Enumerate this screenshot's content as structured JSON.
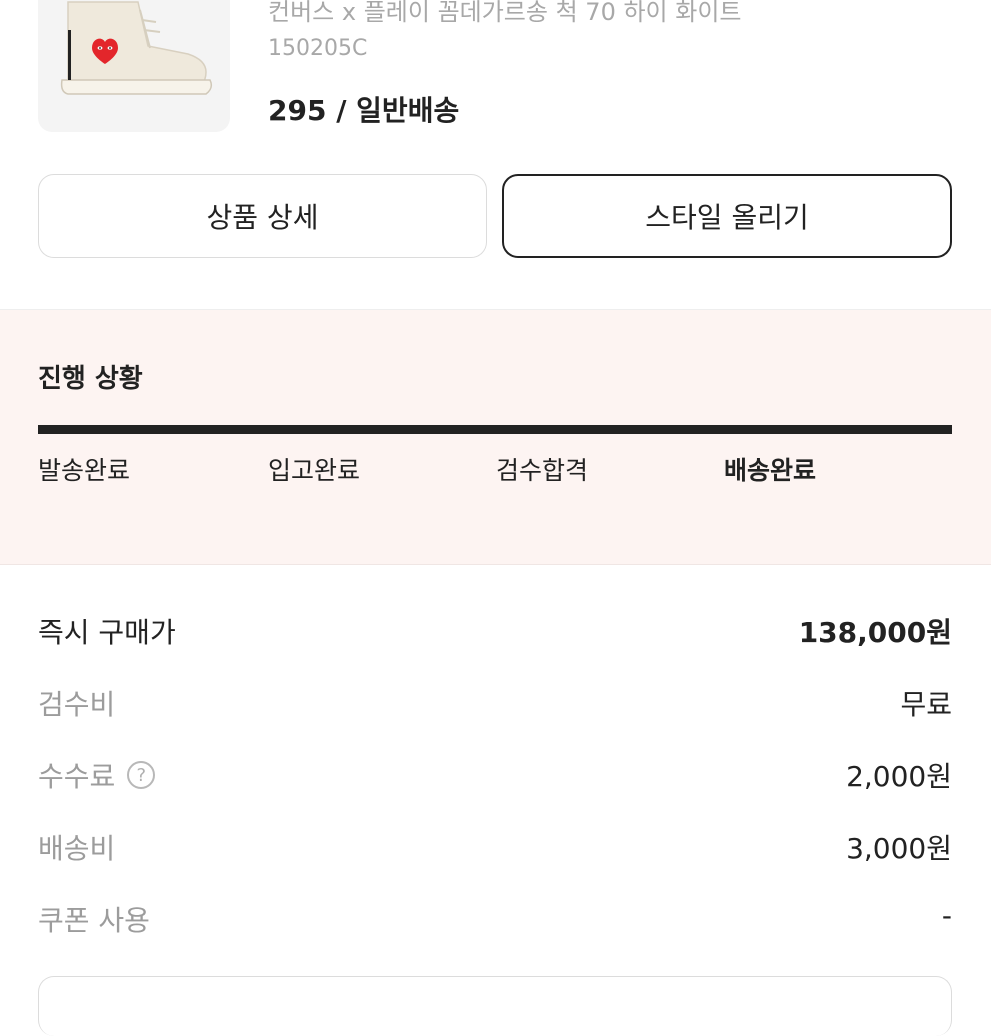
{
  "product": {
    "name": "컨버스 x 플레이 꼼데가르송 척 70 하이 화이트",
    "code": "150205C",
    "option": "295 / 일반배송"
  },
  "actions": {
    "detail_label": "상품 상세",
    "style_label": "스타일 올리기"
  },
  "progress": {
    "title": "진행 상황",
    "steps": [
      "발송완료",
      "입고완료",
      "검수합격",
      "배송완료"
    ],
    "current_step": 4,
    "completed_fraction": 1.0
  },
  "summary": {
    "rows": [
      {
        "label": "즉시 구매가",
        "value": "138,000원"
      },
      {
        "label": "검수비",
        "value": "무료"
      },
      {
        "label": "수수료",
        "value": "2,000원",
        "help": "?"
      },
      {
        "label": "배송비",
        "value": "3,000원"
      },
      {
        "label": "쿠폰 사용",
        "value": "-"
      }
    ]
  },
  "colors": {
    "progress_bg": "#fdf4f2",
    "progress_fill": "#222222",
    "muted_text": "#9c9c9c",
    "logo_heart": "#e3262b"
  }
}
